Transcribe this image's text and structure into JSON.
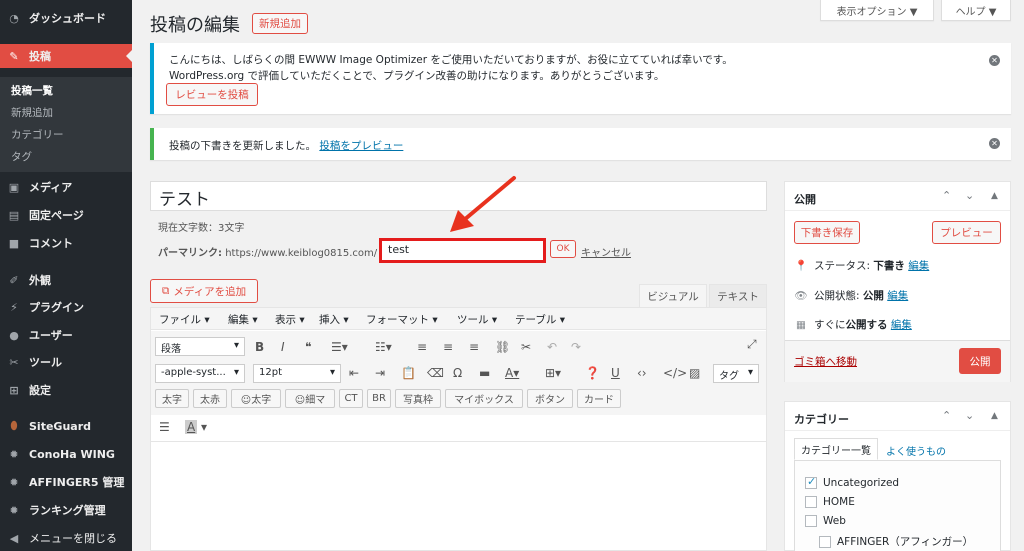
{
  "sidebar": {
    "items": [
      {
        "label": "ダッシュボード",
        "icon": "dashboard-icon"
      },
      {
        "label": "投稿",
        "icon": "pin-icon"
      },
      {
        "label": "メディア",
        "icon": "media-icon"
      },
      {
        "label": "固定ページ",
        "icon": "page-icon"
      },
      {
        "label": "コメント",
        "icon": "comment-icon"
      },
      {
        "label": "外観",
        "icon": "appearance-icon"
      },
      {
        "label": "プラグイン",
        "icon": "plugin-icon"
      },
      {
        "label": "ユーザー",
        "icon": "user-icon"
      },
      {
        "label": "ツール",
        "icon": "tools-icon"
      },
      {
        "label": "設定",
        "icon": "settings-icon"
      },
      {
        "label": "SiteGuard",
        "icon": "siteguard-icon"
      },
      {
        "label": "ConoHa WING",
        "icon": "gear-icon"
      },
      {
        "label": "AFFINGER5 管理",
        "icon": "gear-icon"
      },
      {
        "label": "ランキング管理",
        "icon": "gear-icon"
      },
      {
        "label": "メニューを閉じる",
        "icon": "collapse-icon"
      }
    ],
    "submenu": [
      "投稿一覧",
      "新規追加",
      "カテゴリー",
      "タグ"
    ]
  },
  "header": {
    "title": "投稿の編集",
    "add_new": "新規追加",
    "screen_options": "表示オプション ▼",
    "help": "ヘルプ ▼"
  },
  "notices": {
    "ewww_line1": "こんにちは、しばらくの間 EWWW Image Optimizer をご使用いただいておりますが、お役に立てていれば幸いです。",
    "ewww_line2": "WordPress.org で評価していただくことで、プラグイン改善の助けになります。ありがとうございます。",
    "review_button": "レビューを投稿",
    "updated_text": "投稿の下書きを更新しました。",
    "preview_link": "投稿をプレビュー"
  },
  "post": {
    "title": "テスト",
    "char_count": "現在文字数：3文字",
    "permalink_label": "パーマリンク:",
    "permalink_base": "https://www.keiblog0815.com/",
    "slug": "test",
    "ok": "OK",
    "cancel": "キャンセル"
  },
  "editor": {
    "add_media": "メディアを追加",
    "tab_visual": "ビジュアル",
    "tab_text": "テキスト",
    "menu": [
      "ファイル ▾",
      "編集 ▾",
      "表示 ▾",
      "挿入 ▾",
      "フォーマット ▾",
      "ツール ▾",
      "テーブル ▾"
    ],
    "format_select": "段落",
    "font_select": "-apple-syst...",
    "size_select": "12pt",
    "tag_select": "タグ",
    "quicktags": [
      "太字",
      "太赤",
      "☺太字",
      "☺細マ",
      "CT",
      "BR",
      "写真枠",
      "マイボックス",
      "ボタン",
      "カード"
    ]
  },
  "publish_box": {
    "title": "公開",
    "save_draft": "下書き保存",
    "preview": "プレビュー",
    "status_label": "ステータス:",
    "status_value": "下書き",
    "visibility_label": "公開状態:",
    "visibility_value": "公開",
    "schedule_label": "すぐに",
    "schedule_suffix": "公開する",
    "edit": "編集",
    "trash": "ゴミ箱へ移動",
    "publish": "公開"
  },
  "category_box": {
    "title": "カテゴリー",
    "tab_all": "カテゴリー一覧",
    "tab_popular": "よく使うもの",
    "items": [
      {
        "label": "Uncategorized",
        "checked": true
      },
      {
        "label": "HOME",
        "checked": false
      },
      {
        "label": "Web",
        "checked": false
      },
      {
        "label": "AFFINGER（アフィンガー）",
        "checked": false
      }
    ]
  },
  "colors": {
    "sidebar": "#23282d",
    "accent": "#e14d43",
    "highlight": "#e41c1c",
    "link": "#0073aa"
  }
}
